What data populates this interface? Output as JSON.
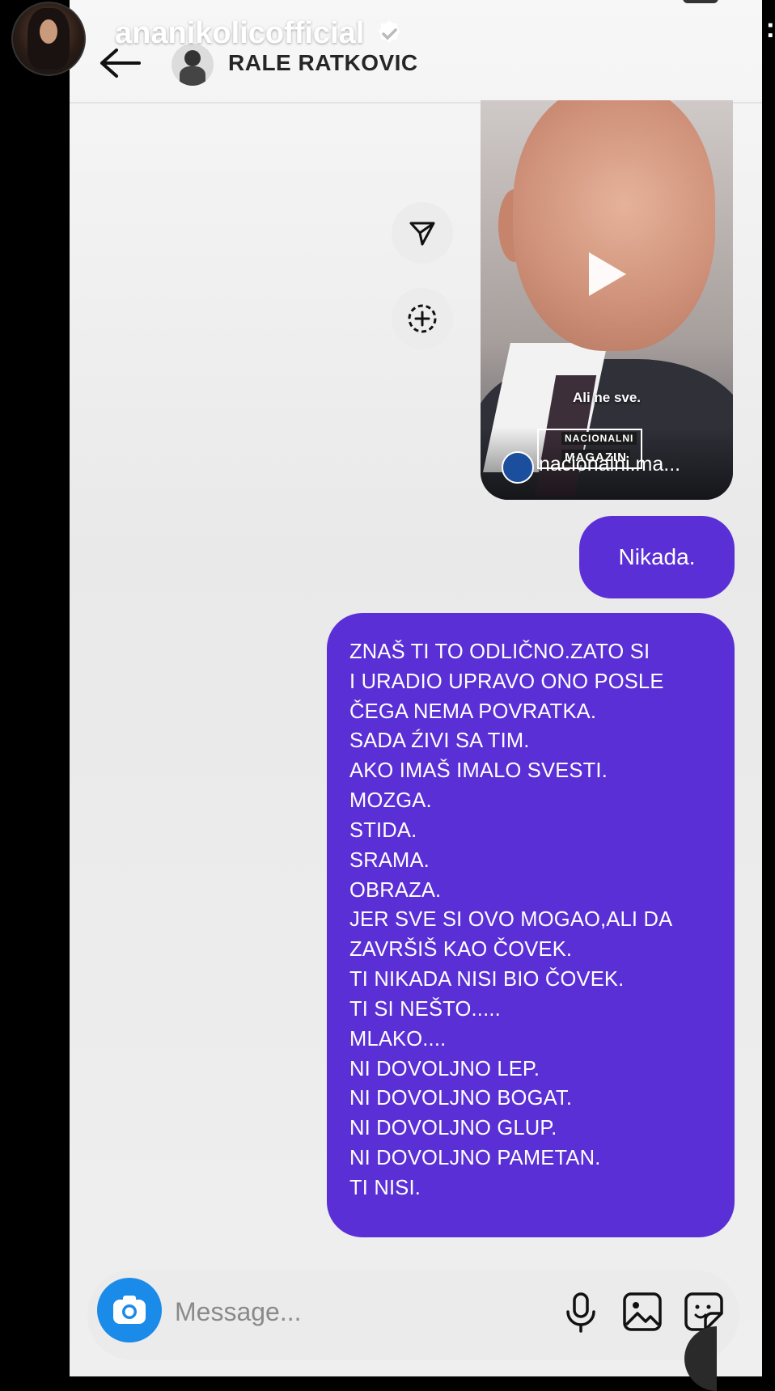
{
  "story": {
    "username": "ananikolicofficial",
    "verified": true
  },
  "header": {
    "contact_name": "RALE RATKOVIC"
  },
  "shared_video": {
    "caption": "Ali ne sve.",
    "brand_top": "NACIONALNI",
    "brand_bottom": "MAGAZIN",
    "source": "nacionalni.ma..."
  },
  "messages": [
    {
      "text": "Nikada."
    },
    {
      "lines": [
        "ZNAŠ TI TO ODLIČNO.ZATO SI",
        "I URADIO UPRAVO ONO POSLE",
        "ČEGA NEMA POVRATKA.",
        "SADA ŹIVI SA TIM.",
        "AKO IMAŠ IMALO SVESTI.",
        "MOZGA.",
        "STIDA.",
        "SRAMA.",
        "OBRAZA.",
        "JER SVE SI OVO MOGAO,ALI DA",
        "ZAVRŠIŠ KAO ČOVEK.",
        "TI NIKADA NISI BIO ČOVEK.",
        "TI SI NEŠTO.....",
        "MLAKO....",
        "NI DOVOLJNO LEP.",
        "NI DOVOLJNO BOGAT.",
        "NI DOVOLJNO GLUP.",
        "NI DOVOLJNO PAMETAN.",
        "TI NISI."
      ]
    }
  ],
  "composer": {
    "placeholder": "Message..."
  },
  "icons": [
    "back-arrow-icon",
    "share-icon",
    "add-story-icon",
    "play-icon",
    "camera-icon",
    "microphone-icon",
    "gallery-icon",
    "sticker-icon",
    "more-icon"
  ],
  "colors": {
    "bubble": "#5b2fd6",
    "camera_button": "#1a8be8"
  }
}
